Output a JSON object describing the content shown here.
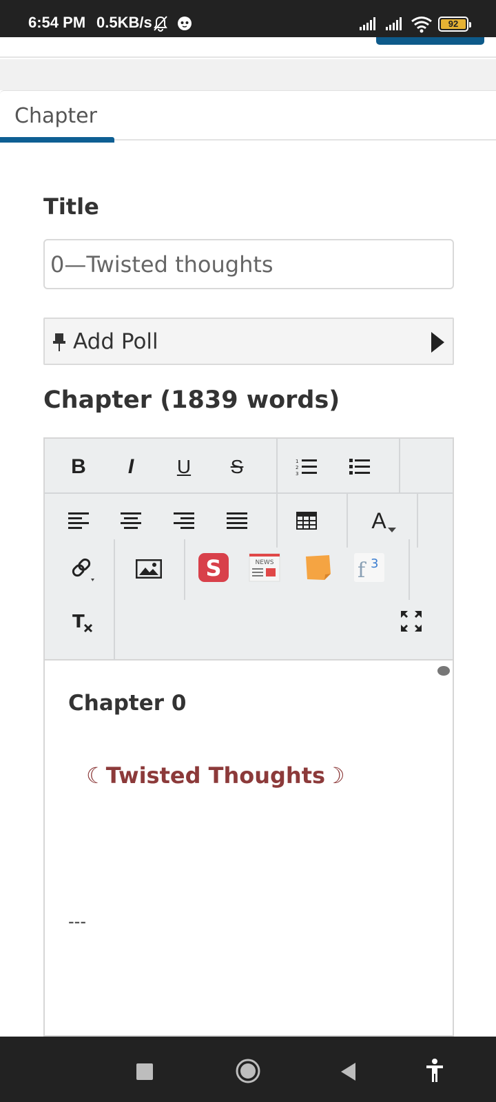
{
  "status_bar": {
    "time": "6:54 PM",
    "net_speed": "0.5KB/s",
    "battery": "92"
  },
  "tabs": [
    {
      "label": "Chapter",
      "active": true
    }
  ],
  "form": {
    "title_label": "Title",
    "title_value": "0—Twisted thoughts",
    "poll_label": "Add Poll",
    "chapter_label": "Chapter (1839 words)"
  },
  "toolbar": {
    "bold": "B",
    "italic": "I",
    "underline": "U",
    "strike": "S",
    "font_color": "A",
    "clear_format": "T",
    "news_badge": "NEWS",
    "f3_base": "f",
    "f3_sup": "3"
  },
  "editor": {
    "heading": "Chapter 0",
    "subheading": "☾Twisted Thoughts☽",
    "divider": "---"
  },
  "colors": {
    "accent": "#0e5f93",
    "subheading": "#8c3a3a",
    "battery": "#e6b233"
  }
}
